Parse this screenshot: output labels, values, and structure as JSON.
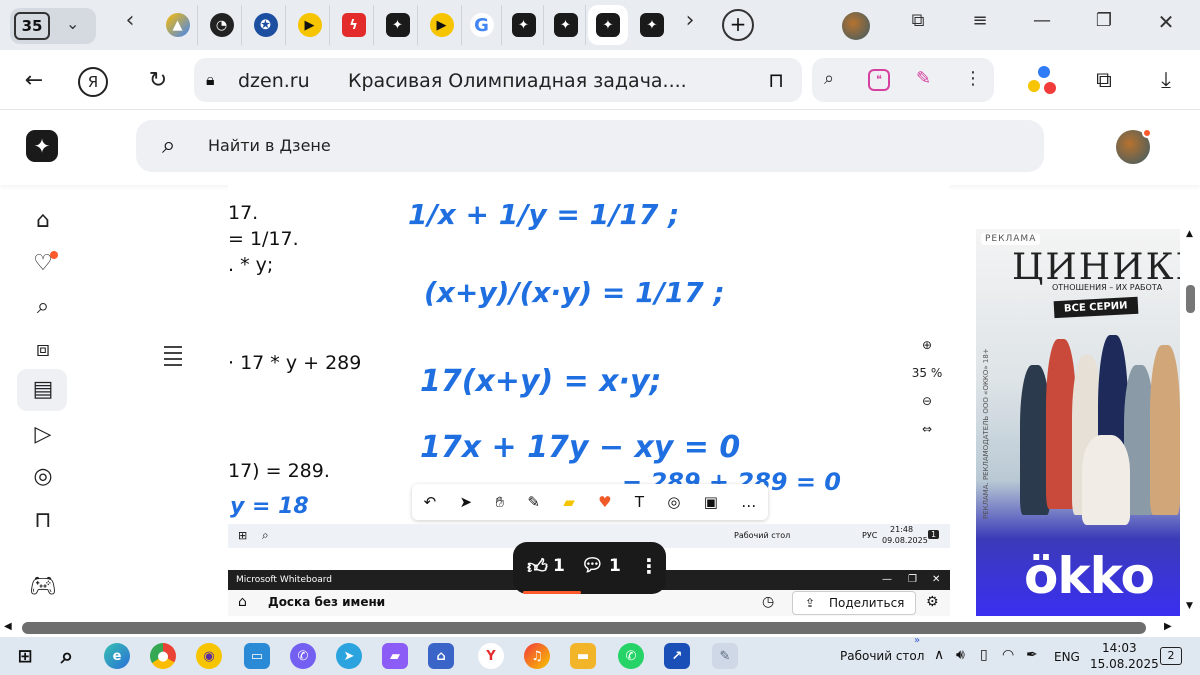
{
  "tabs": {
    "count": "35",
    "icons": [
      "back-arrow",
      "ads",
      "clock",
      "gov",
      "play",
      "power",
      "dzen",
      "play",
      "google",
      "dzen",
      "dzen",
      "dzen-active",
      "dzen",
      "forward-arrow"
    ],
    "new_tab": "+"
  },
  "address_bar": {
    "domain": "dzen.ru",
    "page_title": "Красивая Олимпиадная задача...."
  },
  "dzen": {
    "search_placeholder": "Найти в Дзене"
  },
  "sidebar": {
    "items": [
      "home",
      "subscriptions",
      "search",
      "shorts",
      "articles",
      "video",
      "chat",
      "bookmarks",
      "games"
    ]
  },
  "content": {
    "typed_lines": [
      "17.",
      "= 1/17.",
      ". * y;",
      "· 17 * y + 289",
      "17) = 289."
    ],
    "handwritten": [
      "1/x + 1/y = 1/17 ;",
      "(x+y)/(x·y) = 1/17 ;",
      "17(x+y) = x·y;",
      "17x + 17y − xy = 0",
      "− 289 + 289 = 0",
      "y = 18"
    ],
    "zoom_level": "35 %",
    "inner_taskbar": {
      "desktop_label": "Рабочий стол",
      "lang": "РУС",
      "time": "21:48",
      "date": "09.08.2025",
      "notif": "1"
    },
    "whiteboard": {
      "app_title": "Microsoft Whiteboard",
      "board_name": "Доска без имени",
      "share_label": "Поделиться"
    }
  },
  "actions": {
    "likes": "1",
    "comments": "1"
  },
  "ad": {
    "badge": "РЕКЛАМА",
    "brand": "ЦИНИКИ",
    "tagline": "ОТНОШЕНИЯ – ИХ РАБОТА",
    "cta": "ВСЕ СЕРИИ",
    "logo": "ökko",
    "legal": "РЕКЛАМА. РЕКЛАМОДАТЕЛЬ ООО «ОККО» 18+"
  },
  "taskbar": {
    "desktop_label": "Рабочий стол",
    "lang": "ENG",
    "time": "14:03",
    "date": "15.08.2025",
    "notif": "2"
  },
  "colors": {
    "handwriting": "#1f6fe0",
    "accent": "#ff5a2c",
    "taskbar": "#dfe7f0"
  }
}
